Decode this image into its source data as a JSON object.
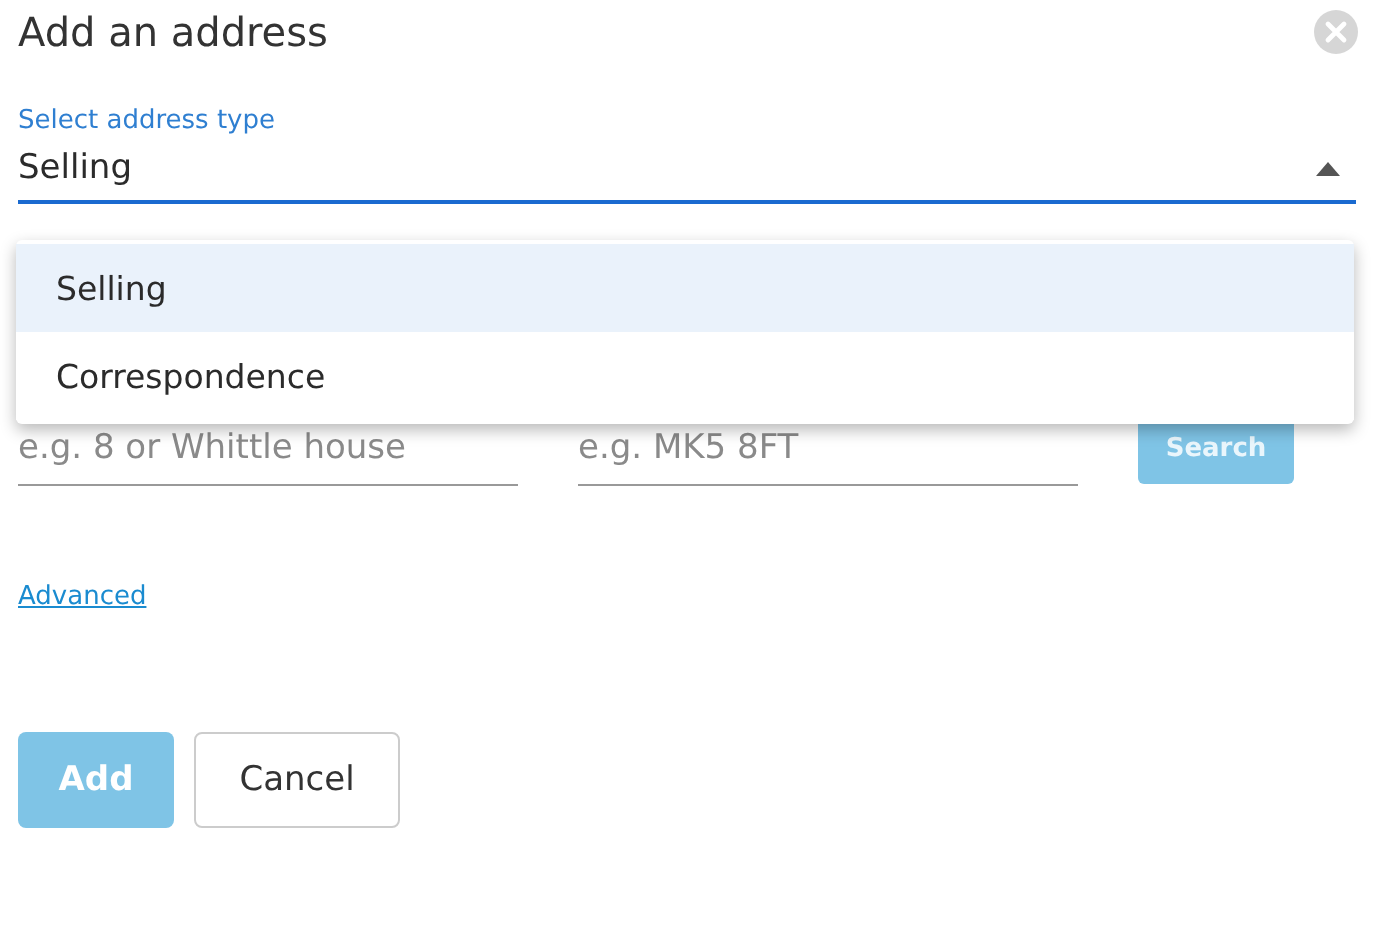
{
  "dialog": {
    "title": "Add an address"
  },
  "address_type": {
    "label": "Select address type",
    "value": "Selling",
    "expanded": true,
    "options": [
      {
        "label": "Selling",
        "selected": true
      },
      {
        "label": "Correspondence",
        "selected": false
      }
    ]
  },
  "lookup": {
    "fields": [
      {
        "placeholder": "e.g. 8 or Whittle house"
      },
      {
        "placeholder": "e.g. MK5 8FT"
      }
    ],
    "search_button": {
      "label": "Search",
      "disabled": true
    }
  },
  "advanced_link": "Advanced",
  "buttons": [
    {
      "label": "Add",
      "kind": "primary",
      "disabled": true
    },
    {
      "label": "Cancel",
      "kind": "secondary",
      "disabled": false
    }
  ]
}
